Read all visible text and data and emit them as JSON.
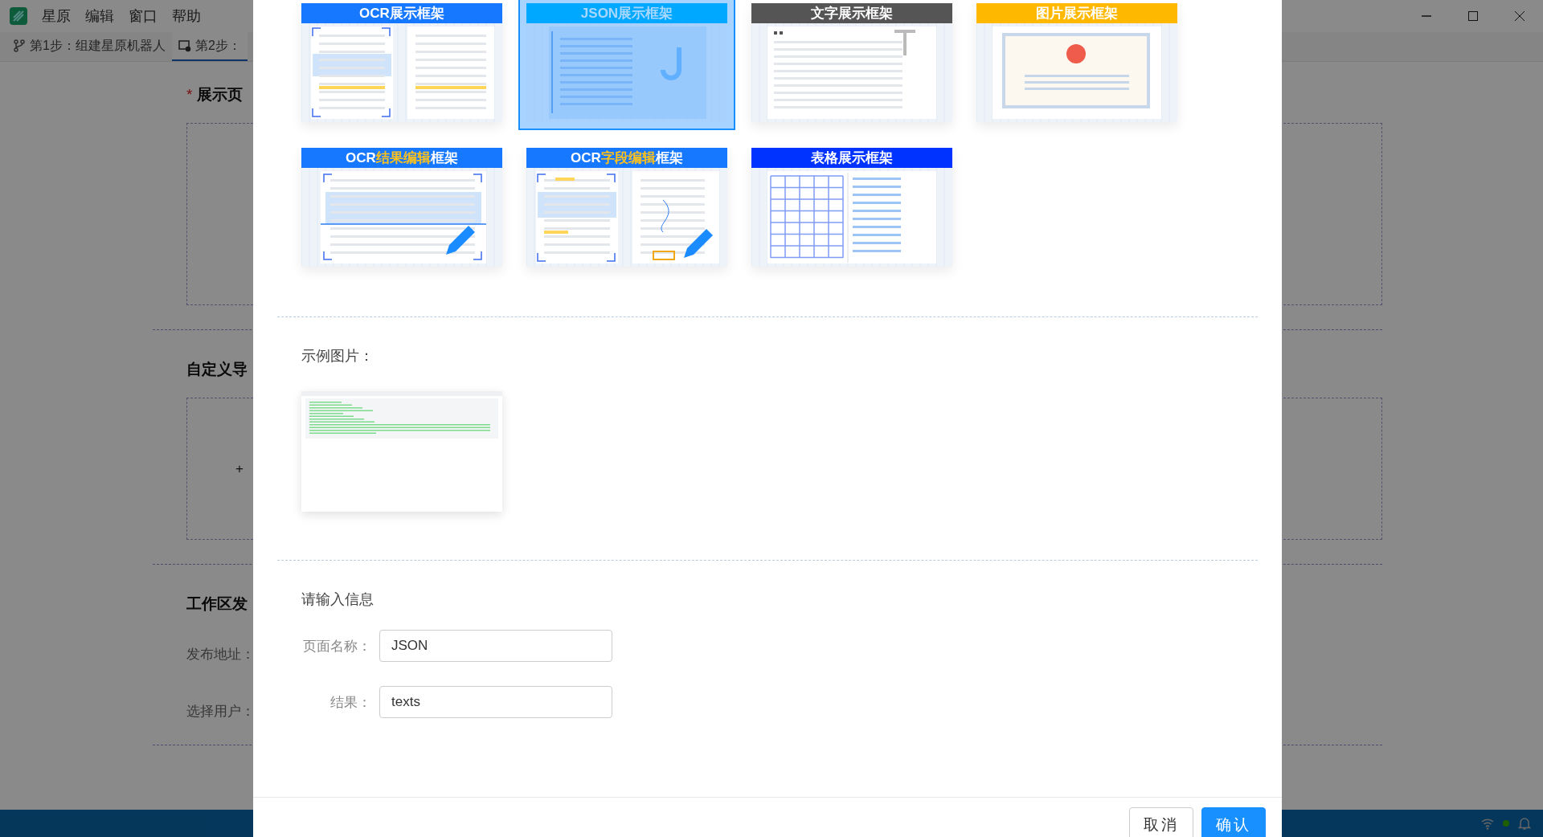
{
  "app": {
    "menu": [
      "星原",
      "编辑",
      "窗口",
      "帮助"
    ],
    "tabs": [
      {
        "label": "第1步：组建星原机器人",
        "selected": false,
        "kind": "branch"
      },
      {
        "label": "第2步：",
        "selected": true,
        "kind": "gear"
      }
    ],
    "sections": [
      {
        "marker": "*",
        "title": "展示页",
        "kind": "box"
      },
      {
        "title": "自定义导",
        "kind": "add",
        "add_label": "+"
      },
      {
        "title": "工作区发",
        "kind": "fields",
        "fields": [
          "发布地址：",
          "选择用户："
        ]
      }
    ]
  },
  "dialog": {
    "frames": [
      {
        "label": [
          {
            "text": "OCR展示框架",
            "accent": false
          }
        ],
        "color": "#1677ff",
        "kind": "ocr",
        "selected": false
      },
      {
        "label": [
          {
            "text": "JSON展示框架",
            "accent": false
          }
        ],
        "color": "#00a8ff",
        "kind": "json",
        "selected": true
      },
      {
        "label": [
          {
            "text": "文字展示框架",
            "accent": false
          }
        ],
        "color": "#555555",
        "kind": "text",
        "selected": false
      },
      {
        "label": [
          {
            "text": "图片展示框架",
            "accent": false
          }
        ],
        "color": "#ffb800",
        "kind": "image",
        "selected": false
      },
      {
        "label": [
          {
            "text": "OCR",
            "accent": false
          },
          {
            "text": "结果编辑",
            "accent": true
          },
          {
            "text": "框架",
            "accent": false
          }
        ],
        "color": "#1677ff",
        "kind": "ocr-edit",
        "selected": false
      },
      {
        "label": [
          {
            "text": "OCR",
            "accent": false
          },
          {
            "text": "字段编辑",
            "accent": true
          },
          {
            "text": "框架",
            "accent": false
          }
        ],
        "color": "#1677ff",
        "kind": "field-edit",
        "selected": false
      },
      {
        "label": [
          {
            "text": "表格展示框架",
            "accent": false
          }
        ],
        "color": "#0033ff",
        "kind": "table",
        "selected": false
      }
    ],
    "example_title": "示例图片：",
    "form_title": "请输入信息",
    "fields": [
      {
        "label": "页面名称：",
        "value": "JSON"
      },
      {
        "label": "结果：",
        "value": "texts"
      }
    ],
    "buttons": [
      {
        "label": "取消",
        "primary": false
      },
      {
        "label": "确认",
        "primary": true
      }
    ]
  }
}
